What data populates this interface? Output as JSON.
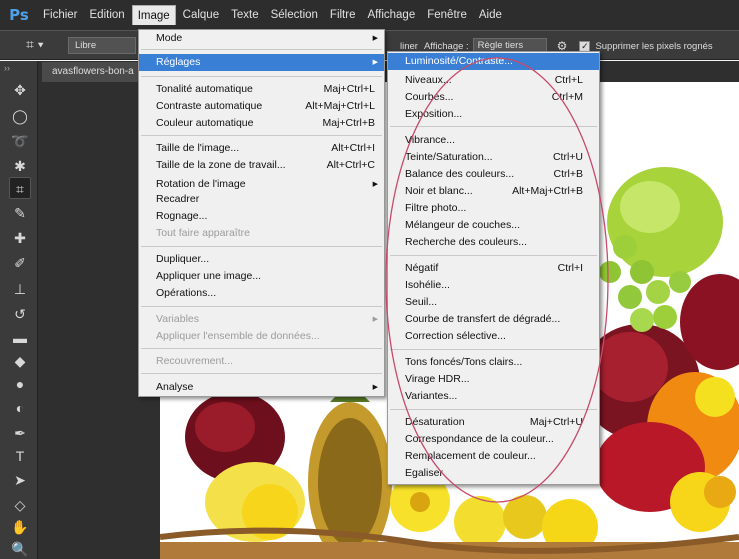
{
  "app": {
    "logo": "Ps"
  },
  "menubar": [
    "Fichier",
    "Edition",
    "Image",
    "Calque",
    "Texte",
    "Sélection",
    "Filtre",
    "Affichage",
    "Fenêtre",
    "Aide"
  ],
  "options_bar": {
    "ratio_value": "Libre",
    "straighten_label": "liner",
    "display_label": "Affichage :",
    "display_value": "Règle tiers",
    "delete_pixels_label": "Supprimer les pixels rognés",
    "delete_pixels_checked": true
  },
  "document": {
    "tab_title": "avasflowers-bon-a"
  },
  "image_menu": {
    "items": [
      {
        "label": "Mode",
        "shortcut": "",
        "submenu": true
      },
      {
        "label": "Réglages",
        "shortcut": "",
        "submenu": true,
        "highlighted": true
      },
      {
        "label": "Tonalité automatique",
        "shortcut": "Maj+Ctrl+L"
      },
      {
        "label": "Contraste automatique",
        "shortcut": "Alt+Maj+Ctrl+L"
      },
      {
        "label": "Couleur automatique",
        "shortcut": "Maj+Ctrl+B"
      },
      {
        "label": "Taille de l'image...",
        "shortcut": "Alt+Ctrl+I"
      },
      {
        "label": "Taille de la zone de travail...",
        "shortcut": "Alt+Ctrl+C"
      },
      {
        "label": "Rotation de l'image",
        "shortcut": "",
        "submenu": true
      },
      {
        "label": "Recadrer",
        "shortcut": ""
      },
      {
        "label": "Rognage...",
        "shortcut": ""
      },
      {
        "label": "Tout faire apparaître",
        "shortcut": "",
        "disabled": true
      },
      {
        "label": "Dupliquer...",
        "shortcut": ""
      },
      {
        "label": "Appliquer une image...",
        "shortcut": ""
      },
      {
        "label": "Opérations...",
        "shortcut": ""
      },
      {
        "label": "Variables",
        "shortcut": "",
        "submenu": true,
        "disabled": true
      },
      {
        "label": "Appliquer l'ensemble de données...",
        "shortcut": "",
        "disabled": true
      },
      {
        "label": "Recouvrement...",
        "shortcut": "",
        "disabled": true
      },
      {
        "label": "Analyse",
        "shortcut": "",
        "submenu": true
      }
    ]
  },
  "reglages_menu": {
    "items": [
      {
        "label": "Luminosité/Contraste...",
        "shortcut": "",
        "highlighted": true
      },
      {
        "label": "Niveaux...",
        "shortcut": "Ctrl+L"
      },
      {
        "label": "Courbes...",
        "shortcut": "Ctrl+M"
      },
      {
        "label": "Exposition...",
        "shortcut": ""
      },
      {
        "label": "Vibrance...",
        "shortcut": ""
      },
      {
        "label": "Teinte/Saturation...",
        "shortcut": "Ctrl+U"
      },
      {
        "label": "Balance des couleurs...",
        "shortcut": "Ctrl+B"
      },
      {
        "label": "Noir et blanc...",
        "shortcut": "Alt+Maj+Ctrl+B"
      },
      {
        "label": "Filtre photo...",
        "shortcut": ""
      },
      {
        "label": "Mélangeur de couches...",
        "shortcut": ""
      },
      {
        "label": "Recherche des couleurs...",
        "shortcut": ""
      },
      {
        "label": "Négatif",
        "shortcut": "Ctrl+I"
      },
      {
        "label": "Isohélie...",
        "shortcut": ""
      },
      {
        "label": "Seuil...",
        "shortcut": ""
      },
      {
        "label": "Courbe de transfert de dégradé...",
        "shortcut": ""
      },
      {
        "label": "Correction sélective...",
        "shortcut": ""
      },
      {
        "label": "Tons foncés/Tons clairs...",
        "shortcut": ""
      },
      {
        "label": "Virage HDR...",
        "shortcut": ""
      },
      {
        "label": "Variantes...",
        "shortcut": ""
      },
      {
        "label": "Désaturation",
        "shortcut": "Maj+Ctrl+U"
      },
      {
        "label": "Correspondance de la couleur...",
        "shortcut": ""
      },
      {
        "label": "Remplacement de couleur...",
        "shortcut": ""
      },
      {
        "label": "Egaliser",
        "shortcut": ""
      }
    ]
  },
  "colors": {
    "menu_highlight": "#3a7fd6",
    "annotation_ellipse": "#c84a6a",
    "ps_blue": "#4ea0e8"
  },
  "tools": [
    "move-tool",
    "marquee-tool",
    "lasso-tool",
    "quick-selection-tool",
    "crop-tool",
    "eyedropper-tool",
    "healing-tool",
    "brush-tool",
    "clone-stamp-tool",
    "history-brush-tool",
    "eraser-tool",
    "paint-bucket-tool",
    "blur-tool",
    "dodge-tool",
    "pen-tool",
    "type-tool",
    "path-selection-tool",
    "shape-tool",
    "hand-tool",
    "zoom-tool"
  ]
}
